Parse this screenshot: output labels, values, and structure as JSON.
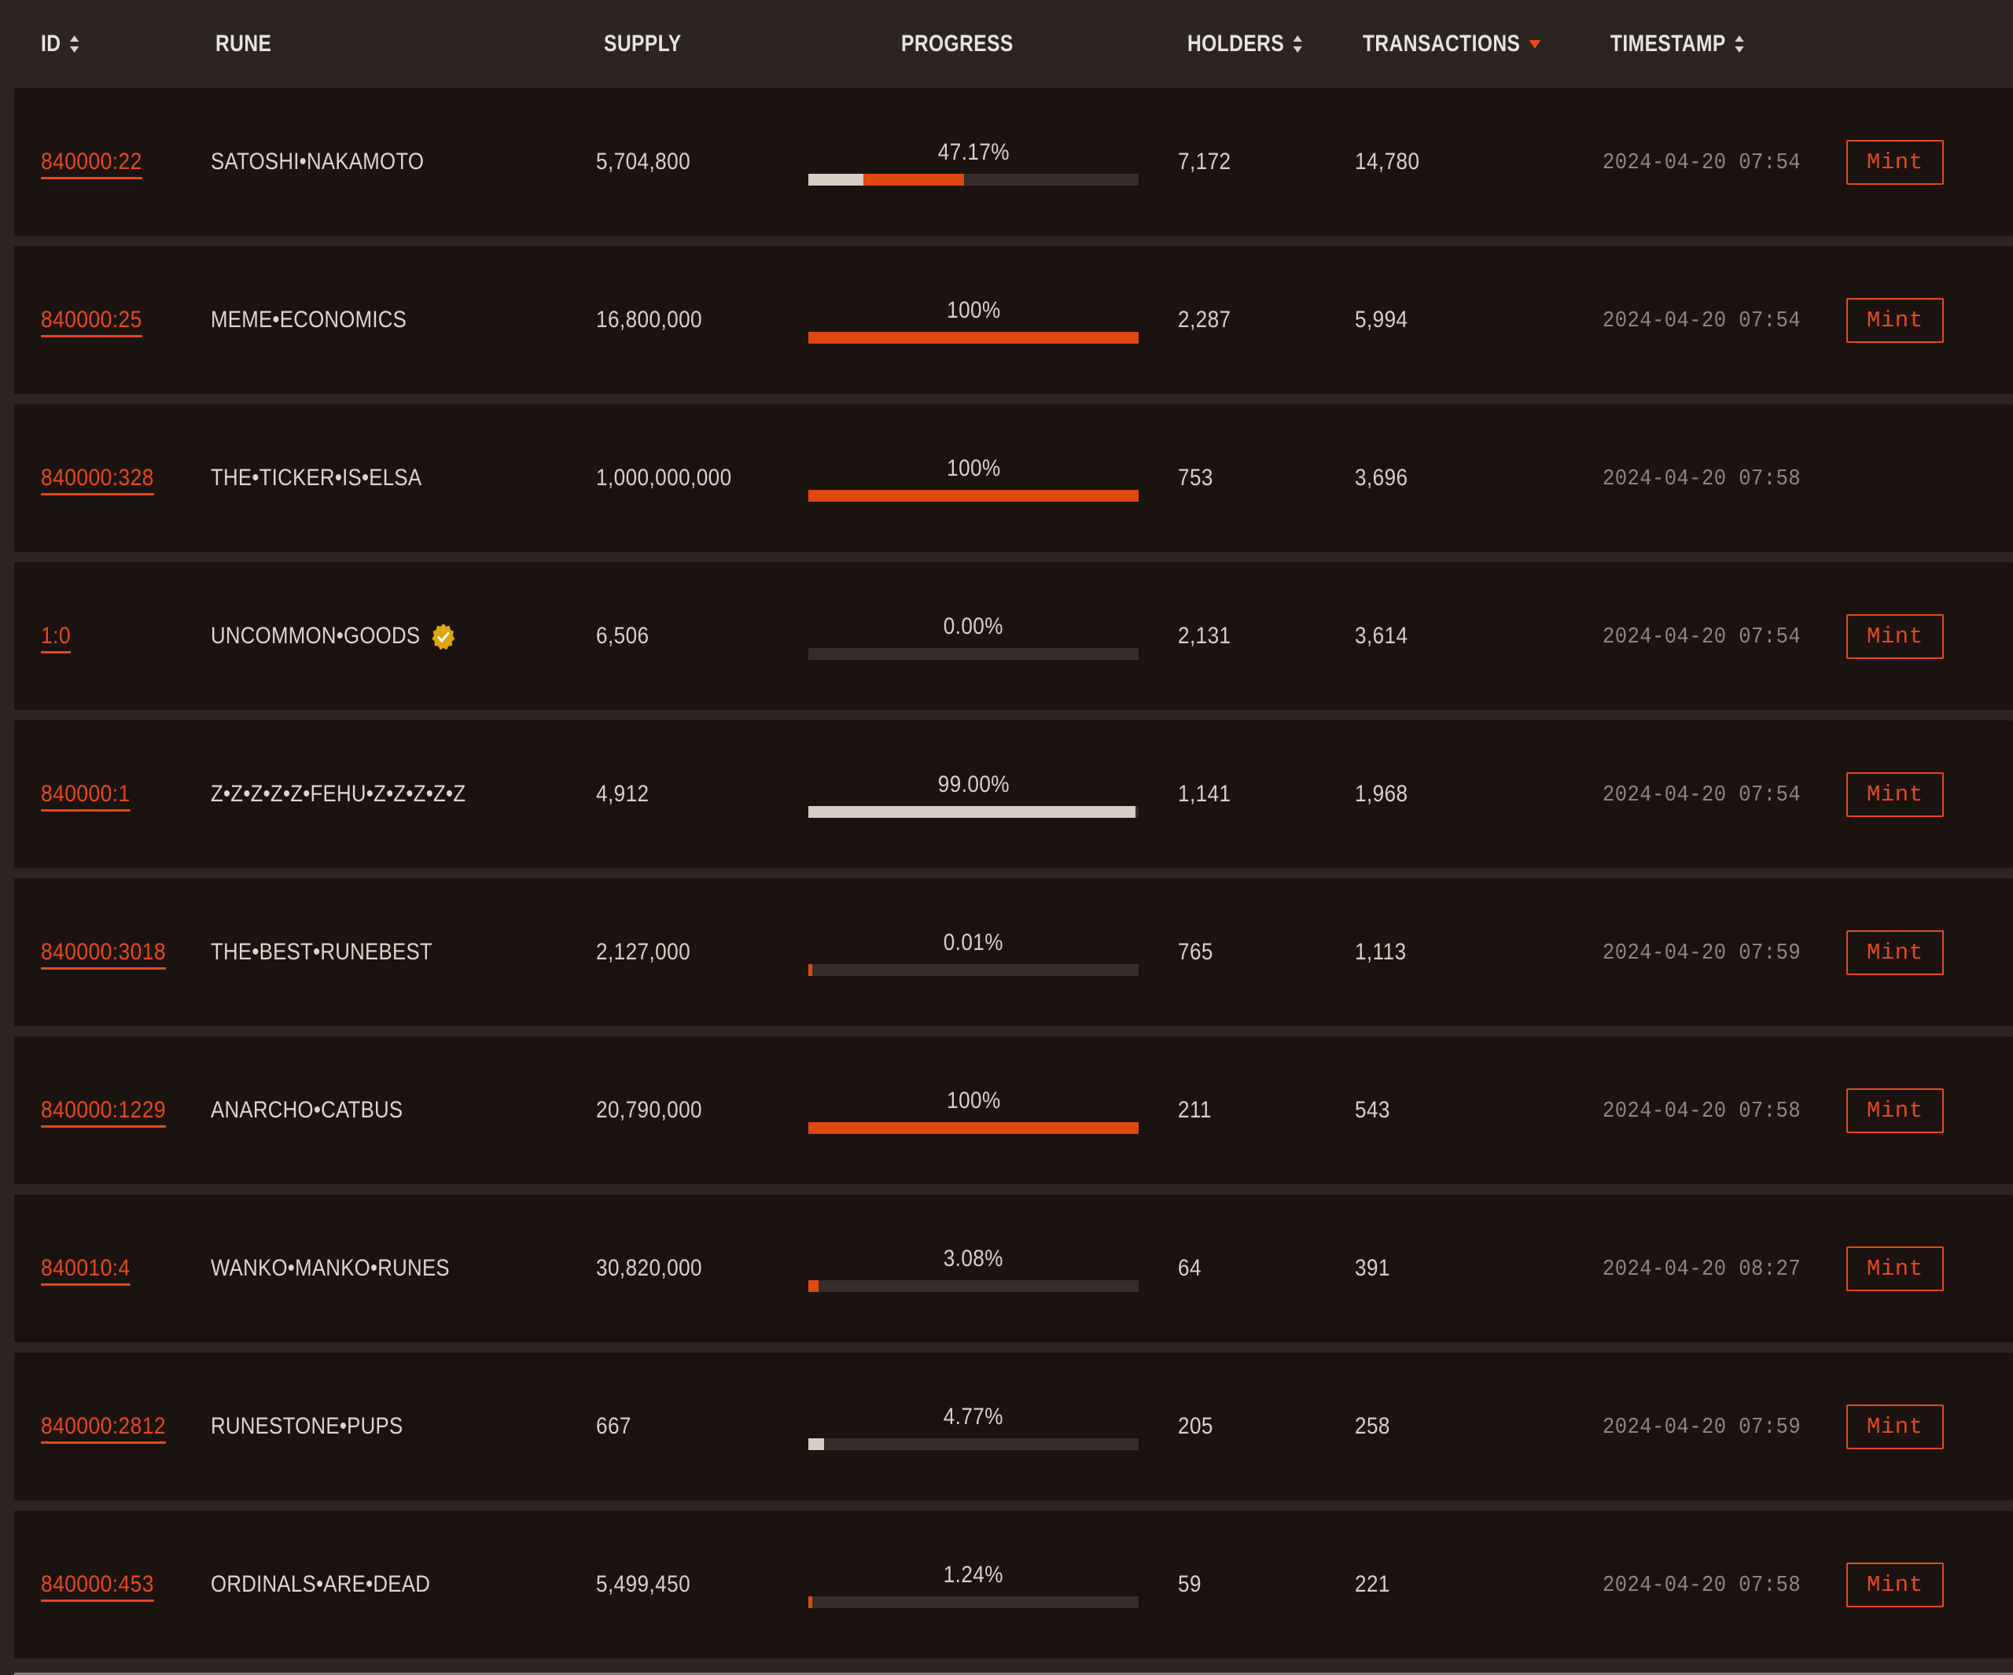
{
  "theme": {
    "page_bg": "#2b2421",
    "row_bg": "#1a1310",
    "accent": "#e8481a",
    "text": "#ddd6ce",
    "muted": "#8d8681",
    "progress_track": "#352d29",
    "progress_light": "#d6cdc4",
    "progress_orange": "#e1480f",
    "badge_gold": "#e0a60c"
  },
  "table": {
    "columns": [
      {
        "key": "id",
        "label": "ID",
        "sortable": true,
        "sort_state": "none",
        "icon": "sort-updown-icon"
      },
      {
        "key": "rune",
        "label": "RUNE",
        "sortable": false,
        "sort_state": "none",
        "icon": ""
      },
      {
        "key": "supply",
        "label": "SUPPLY",
        "sortable": false,
        "sort_state": "none",
        "icon": ""
      },
      {
        "key": "progress",
        "label": "PROGRESS",
        "sortable": false,
        "sort_state": "none",
        "icon": ""
      },
      {
        "key": "holders",
        "label": "HOLDERS",
        "sortable": true,
        "sort_state": "none",
        "icon": "sort-updown-icon"
      },
      {
        "key": "transactions",
        "label": "TRANSACTIONS",
        "sortable": true,
        "sort_state": "desc",
        "icon": "chevron-down-icon"
      },
      {
        "key": "timestamp",
        "label": "TIMESTAMP",
        "sortable": true,
        "sort_state": "none",
        "icon": "sort-updown-icon"
      },
      {
        "key": "action",
        "label": "",
        "sortable": false,
        "sort_state": "none",
        "icon": ""
      }
    ],
    "mint_label": "Mint",
    "rows": [
      {
        "id": "840000:22",
        "rune": "SATOSHI•NAKAMOTO",
        "verified": false,
        "supply": "5,704,800",
        "progress_label": "47.17%",
        "progress_pct": 47.17,
        "progress_premine_pct": 16.6,
        "holders": "7,172",
        "transactions": "14,780",
        "timestamp": "2024-04-20 07:54",
        "mintable": true
      },
      {
        "id": "840000:25",
        "rune": "MEME•ECONOMICS",
        "verified": false,
        "supply": "16,800,000",
        "progress_label": "100%",
        "progress_pct": 100,
        "progress_premine_pct": 0,
        "holders": "2,287",
        "transactions": "5,994",
        "timestamp": "2024-04-20 07:54",
        "mintable": true
      },
      {
        "id": "840000:328",
        "rune": "THE•TICKER•IS•ELSA",
        "verified": false,
        "supply": "1,000,000,000",
        "progress_label": "100%",
        "progress_pct": 100,
        "progress_premine_pct": 0,
        "holders": "753",
        "transactions": "3,696",
        "timestamp": "2024-04-20 07:58",
        "mintable": false
      },
      {
        "id": "1:0",
        "rune": "UNCOMMON•GOODS",
        "verified": true,
        "supply": "6,506",
        "progress_label": "0.00%",
        "progress_pct": 0,
        "progress_premine_pct": 0,
        "holders": "2,131",
        "transactions": "3,614",
        "timestamp": "2024-04-20 07:54",
        "mintable": true
      },
      {
        "id": "840000:1",
        "rune": "Z•Z•Z•Z•Z•FEHU•Z•Z•Z•Z•Z",
        "verified": false,
        "supply": "4,912",
        "progress_label": "99.00%",
        "progress_pct": 99,
        "progress_premine_pct": 99,
        "holders": "1,141",
        "transactions": "1,968",
        "timestamp": "2024-04-20 07:54",
        "mintable": true
      },
      {
        "id": "840000:3018",
        "rune": "THE•BEST•RUNEBEST",
        "verified": false,
        "supply": "2,127,000",
        "progress_label": "0.01%",
        "progress_pct": 0.01,
        "progress_premine_pct": 0,
        "holders": "765",
        "transactions": "1,113",
        "timestamp": "2024-04-20 07:59",
        "mintable": true
      },
      {
        "id": "840000:1229",
        "rune": "ANARCHO•CATBUS",
        "verified": false,
        "supply": "20,790,000",
        "progress_label": "100%",
        "progress_pct": 100,
        "progress_premine_pct": 0,
        "holders": "211",
        "transactions": "543",
        "timestamp": "2024-04-20 07:58",
        "mintable": true
      },
      {
        "id": "840010:4",
        "rune": "WANKO•MANKO•RUNES",
        "verified": false,
        "supply": "30,820,000",
        "progress_label": "3.08%",
        "progress_pct": 3.08,
        "progress_premine_pct": 0,
        "holders": "64",
        "transactions": "391",
        "timestamp": "2024-04-20 08:27",
        "mintable": true
      },
      {
        "id": "840000:2812",
        "rune": "RUNESTONE•PUPS",
        "verified": false,
        "supply": "667",
        "progress_label": "4.77%",
        "progress_pct": 4.77,
        "progress_premine_pct": 4.77,
        "holders": "205",
        "transactions": "258",
        "timestamp": "2024-04-20 07:59",
        "mintable": true
      },
      {
        "id": "840000:453",
        "rune": "ORDINALS•ARE•DEAD",
        "verified": false,
        "supply": "5,499,450",
        "progress_label": "1.24%",
        "progress_pct": 1.24,
        "progress_premine_pct": 0,
        "holders": "59",
        "transactions": "221",
        "timestamp": "2024-04-20 07:58",
        "mintable": true
      }
    ]
  }
}
